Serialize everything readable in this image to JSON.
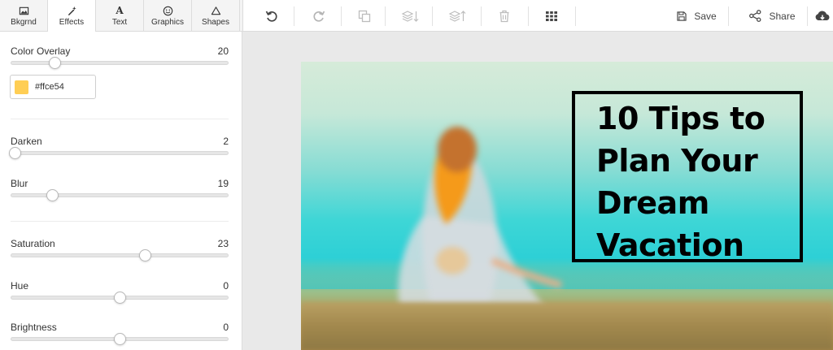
{
  "tabs": [
    {
      "label": "Bkgrnd",
      "icon": "image-icon"
    },
    {
      "label": "Effects",
      "icon": "magic-wand-icon"
    },
    {
      "label": "Text",
      "icon": "text-icon"
    },
    {
      "label": "Graphics",
      "icon": "smiley-icon"
    },
    {
      "label": "Shapes",
      "icon": "triangle-icon"
    }
  ],
  "active_tab": "Effects",
  "toolbar": {
    "save_label": "Save",
    "share_label": "Share"
  },
  "effects": {
    "color_overlay": {
      "label": "Color Overlay",
      "value": "20",
      "fraction": 0.2
    },
    "overlay_color": {
      "hex": "#ffce54"
    },
    "darken": {
      "label": "Darken",
      "value": "2",
      "fraction": 0.02
    },
    "blur": {
      "label": "Blur",
      "value": "19",
      "fraction": 0.19
    },
    "saturation": {
      "label": "Saturation",
      "value": "23",
      "fraction": 0.615
    },
    "hue": {
      "label": "Hue",
      "value": "0",
      "fraction": 0.5
    },
    "brightness": {
      "label": "Brightness",
      "value": "0",
      "fraction": 0.5
    }
  },
  "canvas": {
    "title": "10 Tips to\nPlan Your\nDream\nVacation"
  },
  "colors": {
    "overlay": "#ffce54",
    "panel_bg": "#ffffff",
    "workspace_bg": "#e9e9e9"
  }
}
